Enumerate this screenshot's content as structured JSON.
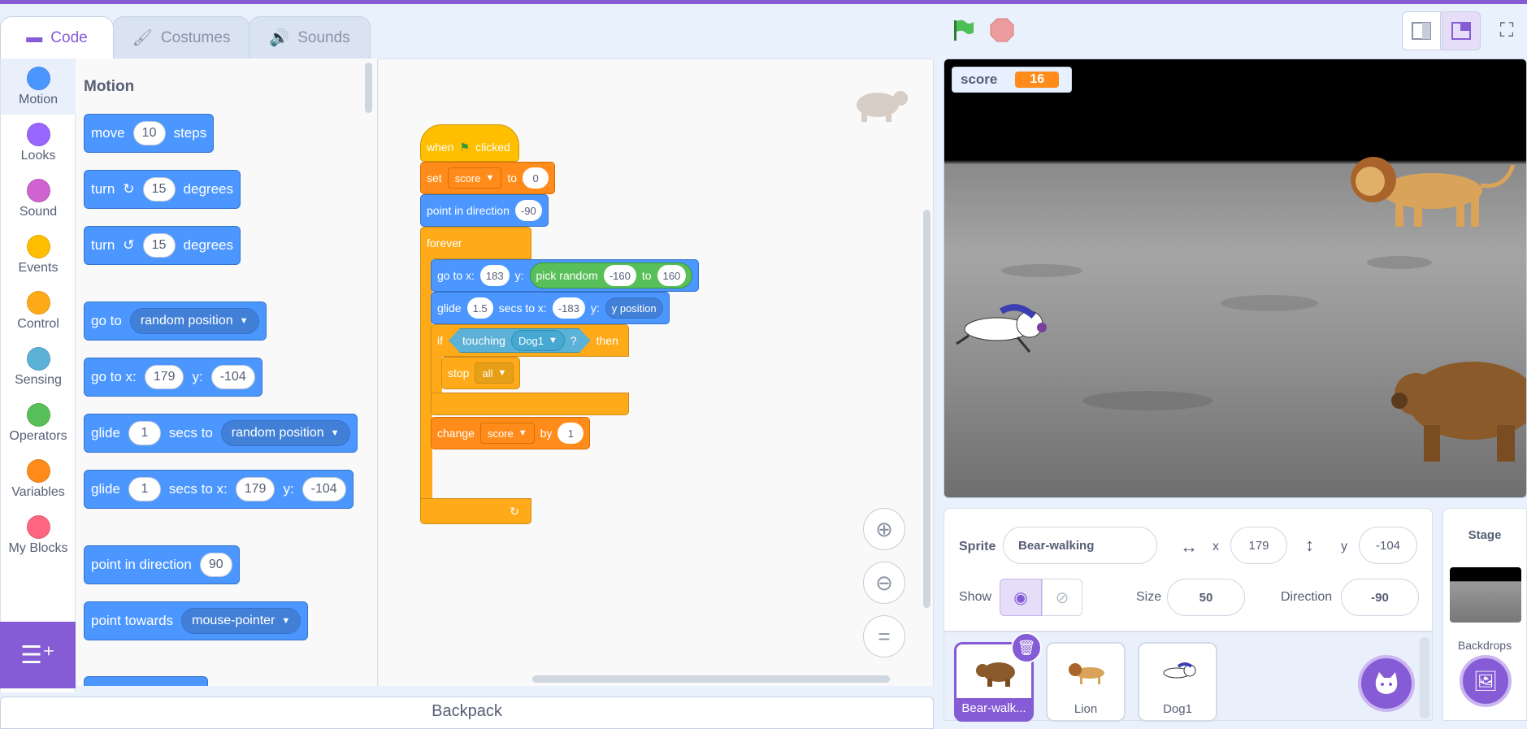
{
  "tabs": [
    {
      "label": "Code",
      "icon": "code-icon"
    },
    {
      "label": "Costumes",
      "icon": "brush-icon"
    },
    {
      "label": "Sounds",
      "icon": "speaker-icon"
    }
  ],
  "categories": [
    {
      "label": "Motion",
      "color": "#4c97ff"
    },
    {
      "label": "Looks",
      "color": "#9966ff"
    },
    {
      "label": "Sound",
      "color": "#cf63cf"
    },
    {
      "label": "Events",
      "color": "#ffbf00"
    },
    {
      "label": "Control",
      "color": "#ffab19"
    },
    {
      "label": "Sensing",
      "color": "#5cb1d6"
    },
    {
      "label": "Operators",
      "color": "#59c059"
    },
    {
      "label": "Variables",
      "color": "#ff8c1a"
    },
    {
      "label": "My Blocks",
      "color": "#ff6680"
    }
  ],
  "palette": {
    "title": "Motion",
    "move": {
      "a": "move",
      "v": "10",
      "b": "steps"
    },
    "turn_right": {
      "a": "turn",
      "v": "15",
      "b": "degrees"
    },
    "turn_left": {
      "a": "turn",
      "v": "15",
      "b": "degrees"
    },
    "goto_random": {
      "a": "go to",
      "d": "random position"
    },
    "goto_xy": {
      "a": "go to x:",
      "x": "179",
      "b": "y:",
      "y": "-104"
    },
    "glide_random": {
      "a": "glide",
      "v": "1",
      "b": "secs to",
      "d": "random position"
    },
    "glide_xy": {
      "a": "glide",
      "v": "1",
      "b": "secs to x:",
      "x": "179",
      "c": "y:",
      "y": "-104"
    },
    "point_dir": {
      "a": "point in direction",
      "v": "90"
    },
    "point_towards": {
      "a": "point towards",
      "d": "mouse-pointer"
    }
  },
  "script": {
    "when": "when",
    "clicked": "clicked",
    "set": "set",
    "set_var": "score",
    "set_to": "to",
    "set_val": "0",
    "point": "point in direction",
    "point_val": "-90",
    "forever": "forever",
    "goto": "go to x:",
    "goto_x": "183",
    "goto_y": "y:",
    "pick": "pick random",
    "pick_a": "-160",
    "pick_to": "to",
    "pick_b": "160",
    "glide": "glide",
    "glide_secs": "1.5",
    "glide_to": "secs to x:",
    "glide_x": "-183",
    "glide_y": "y:",
    "ypos": "y position",
    "if": "if",
    "touching": "touching",
    "touching_obj": "Dog1",
    "q": "?",
    "then": "then",
    "stop": "stop",
    "stop_opt": "all",
    "change": "change",
    "change_var": "score",
    "change_by": "by",
    "change_val": "1"
  },
  "backpack": "Backpack",
  "monitor": {
    "label": "score",
    "value": "16"
  },
  "sprite_info": {
    "sprite_label": "Sprite",
    "sprite_name": "Bear-walking",
    "x_label": "x",
    "x_value": "179",
    "y_label": "y",
    "y_value": "-104",
    "show_label": "Show",
    "size_label": "Size",
    "size_value": "50",
    "direction_label": "Direction",
    "direction_value": "-90"
  },
  "sprites": [
    {
      "name": "Bear-walk...",
      "selected": true
    },
    {
      "name": "Lion",
      "selected": false
    },
    {
      "name": "Dog1",
      "selected": false
    }
  ],
  "stage_pane": {
    "title": "Stage",
    "backdrops": "Backdrops"
  }
}
